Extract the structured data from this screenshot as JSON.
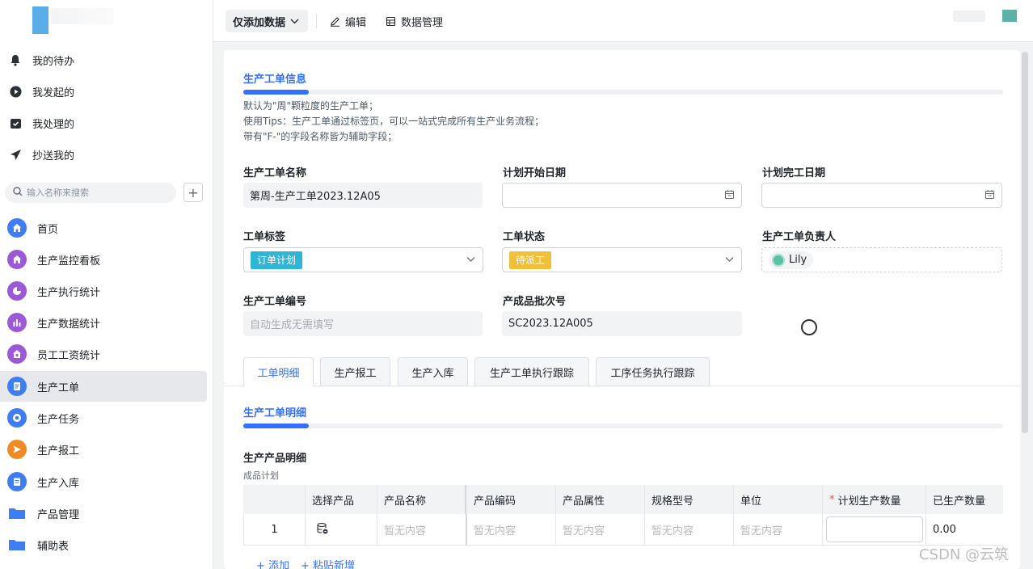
{
  "sidebar": {
    "quick": [
      {
        "label": "我的待办",
        "icon": "bell-icon"
      },
      {
        "label": "我发起的",
        "icon": "play-circle-icon"
      },
      {
        "label": "我处理的",
        "icon": "inbox-check-icon"
      },
      {
        "label": "抄送我的",
        "icon": "paper-plane-icon"
      }
    ],
    "search_placeholder": "输入名称来搜索",
    "add_label": "+",
    "nav": [
      {
        "label": "首页",
        "icon": "home-icon",
        "color": "#3f7df2"
      },
      {
        "label": "生产监控看板",
        "icon": "home-icon",
        "color": "#9b59d8"
      },
      {
        "label": "生产执行统计",
        "icon": "pie-chart-icon",
        "color": "#9b59d8"
      },
      {
        "label": "生产数据统计",
        "icon": "bar-chart-icon",
        "color": "#9b59d8"
      },
      {
        "label": "员工工资统计",
        "icon": "home-icon",
        "color": "#9b59d8"
      },
      {
        "label": "生产工单",
        "icon": "document-icon",
        "color": "#3f7df2",
        "active": true
      },
      {
        "label": "生产任务",
        "icon": "target-icon",
        "color": "#3f7df2"
      },
      {
        "label": "生产报工",
        "icon": "send-icon",
        "color": "#f08a24"
      },
      {
        "label": "生产入库",
        "icon": "clipboard-icon",
        "color": "#3f7df2"
      },
      {
        "label": "产品管理",
        "icon": "folder-icon",
        "color": "#3f7df2"
      },
      {
        "label": "辅助表",
        "icon": "folder-icon",
        "color": "#3f7df2"
      }
    ]
  },
  "toolbar": {
    "mode_label": "仅添加数据",
    "edit_label": "编辑",
    "data_manage_label": "数据管理"
  },
  "form": {
    "section_title": "生产工单信息",
    "description": [
      "默认为\"周\"颗粒度的生产工单；",
      "使用Tips：生产工单通过标签页，可以一站式完成所有生产业务流程；",
      "带有\"F-\"的字段名称皆为辅助字段；"
    ],
    "fields": {
      "name_label": "生产工单名称",
      "name_value": "第周-生产工单2023.12A05",
      "plan_start_label": "计划开始日期",
      "plan_end_label": "计划完工日期",
      "tag_label": "工单标签",
      "tag_value": "订单计划",
      "tag_color": "#2fb5d6",
      "status_label": "工单状态",
      "status_value": "待派工",
      "status_color": "#f0c038",
      "owner_label": "生产工单负责人",
      "owner_value": "Lily",
      "number_label": "生产工单编号",
      "number_placeholder": "自动生成无需填写",
      "batch_label": "产成品批次号",
      "batch_value": "SC2023.12A005"
    }
  },
  "tabs": [
    "工单明细",
    "生产报工",
    "生产入库",
    "生产工单执行跟踪",
    "工序任务执行跟踪"
  ],
  "detail": {
    "section_title": "生产工单明细",
    "sub_label": "生产产品明细",
    "sub_desc": "成品计划",
    "columns": [
      "",
      "选择产品",
      "产品名称",
      "产品编码",
      "产品属性",
      "规格型号",
      "单位",
      "计划生产数量",
      "已生产数量"
    ],
    "required_mark": "*",
    "row": {
      "index": "1",
      "name": "暂无内容",
      "code": "暂无内容",
      "attr": "暂无内容",
      "spec": "暂无内容",
      "unit": "暂无内容",
      "produced": "0.00"
    },
    "add_label": "+ 添加",
    "paste_label": "+ 粘贴新增"
  },
  "watermark": "CSDN @云筑"
}
